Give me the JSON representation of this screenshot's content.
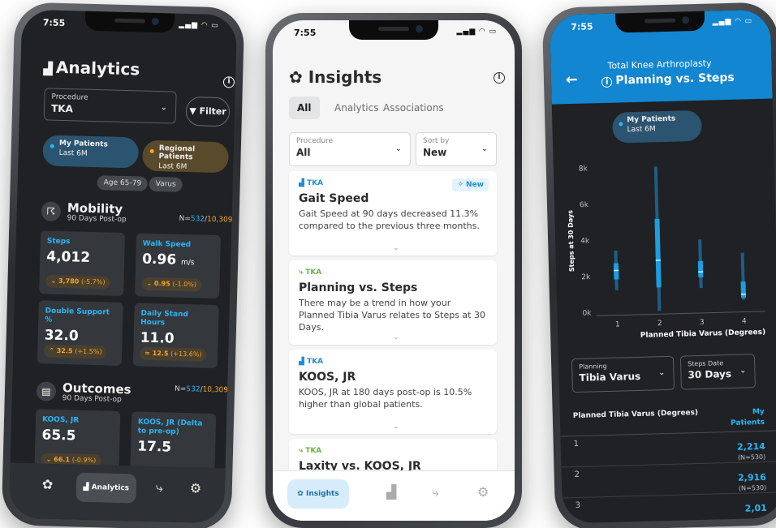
{
  "status_bar": {
    "time": "7:55",
    "icons": "▂▄▆ ◠ ▭"
  },
  "colors": {
    "accent_blue": "#29b6f6",
    "accent_orange": "#f5a623",
    "header_blue": "#1286d0"
  },
  "analytics": {
    "title": "Analytics",
    "title_icon": "chart-icon",
    "info_icon": "i",
    "procedure": {
      "label": "Procedure",
      "value": "TKA"
    },
    "filter_button": "Filter",
    "cohorts": [
      {
        "name": "My Patients",
        "period": "Last 6M"
      },
      {
        "name": "Regional Patients",
        "period": "Last 6M"
      }
    ],
    "tags": [
      "Age 65-79",
      "Varus"
    ],
    "mobility": {
      "title": "Mobility",
      "subtitle": "90 Days Post-op",
      "n_prefix": "N=",
      "n_mine": "532",
      "n_sep": "/",
      "n_regional": "10,309",
      "cards": [
        {
          "label": "Steps",
          "value": "4,012",
          "unit": "",
          "delta_value": "3,780",
          "delta_pct": "(-5.7%)",
          "arrow": "⌄"
        },
        {
          "label": "Walk Speed",
          "value": "0.96",
          "unit": "m/s",
          "delta_value": "0.95",
          "delta_pct": "(-1.0%)",
          "arrow": "⌄"
        },
        {
          "label": "Double Support %",
          "value": "32.0",
          "unit": "",
          "delta_value": "32.5",
          "delta_pct": "(+1.5%)",
          "arrow": "⌃"
        },
        {
          "label": "Daily Stand Hours",
          "value": "11.0",
          "unit": "",
          "delta_value": "12.5",
          "delta_pct": "(+13.6%)",
          "arrow": "≈"
        }
      ]
    },
    "outcomes": {
      "title": "Outcomes",
      "subtitle": "90 Days Post-op",
      "n_prefix": "N=",
      "n_mine": "532",
      "n_sep": "/",
      "n_regional": "10,309",
      "cards": [
        {
          "label": "KOOS, JR",
          "value": "65.5",
          "delta_value": "66.1",
          "delta_pct": "(-0.9%)",
          "arrow": "⌄"
        },
        {
          "label": "KOOS, JR (Delta to pre-op)",
          "value": "17.5"
        }
      ]
    },
    "nav": {
      "active_label": "Analytics"
    }
  },
  "insights": {
    "title": "Insights",
    "info_icon": "i",
    "tabs": [
      "All",
      "Analytics",
      "Associations"
    ],
    "procedure": {
      "label": "Procedure",
      "value": "All"
    },
    "sort": {
      "label": "Sort by",
      "value": "New"
    },
    "cards": [
      {
        "tag": "TKA",
        "badge": "New",
        "title": "Gait Speed",
        "body": "Gait Speed at 90 days decreased 11.3% compared to the previous three months."
      },
      {
        "tag": "TKA",
        "title": "Planning vs. Steps",
        "body": "There may be a trend in how your Planned Tibia Varus relates to Steps at 30 Days."
      },
      {
        "tag": "TKA",
        "title": "KOOS, JR",
        "body": "KOOS, JR at 180 days post-op is 10.5% higher than global patients."
      },
      {
        "tag": "TKA",
        "title": "Laxity vs. KOOS, JR"
      }
    ],
    "nav": {
      "active_label": "Insights"
    }
  },
  "planning": {
    "header_line1": "Total Knee Arthroplasty",
    "header_line2": "Planning vs. Steps",
    "header_info": "i",
    "cohort": {
      "name": "My Patients",
      "period": "Last 6M"
    },
    "planning_select": {
      "label": "Planning",
      "value": "Tibia Varus"
    },
    "steps_select": {
      "label": "Steps Date",
      "value": "30 Days"
    },
    "table": {
      "col1": "Planned Tibia Varus (Degrees)",
      "col2": "My Patients",
      "rows": [
        {
          "key": "1",
          "value": "2,214",
          "n": "(N=530)"
        },
        {
          "key": "2",
          "value": "2,916",
          "n": "(N=530)"
        },
        {
          "key": "3",
          "value": "2,01"
        }
      ]
    }
  },
  "chart_data": {
    "type": "box",
    "xlabel": "Planned Tibia Varus (Degrees)",
    "ylabel": "Steps at 30 Days",
    "categories": [
      "1",
      "2",
      "3",
      "4"
    ],
    "y_ticks": [
      "0k",
      "2k",
      "4k",
      "6k",
      "8k"
    ],
    "ylim": [
      0,
      8000
    ],
    "series": [
      {
        "name": "My Patients",
        "min": [
          1200,
          0,
          1200,
          500
        ],
        "q1": [
          1800,
          1300,
          1800,
          600
        ],
        "median": [
          2300,
          2800,
          2100,
          800
        ],
        "q3": [
          2700,
          5100,
          2700,
          1500
        ],
        "max": [
          3400,
          8000,
          3900,
          3100
        ]
      }
    ]
  }
}
